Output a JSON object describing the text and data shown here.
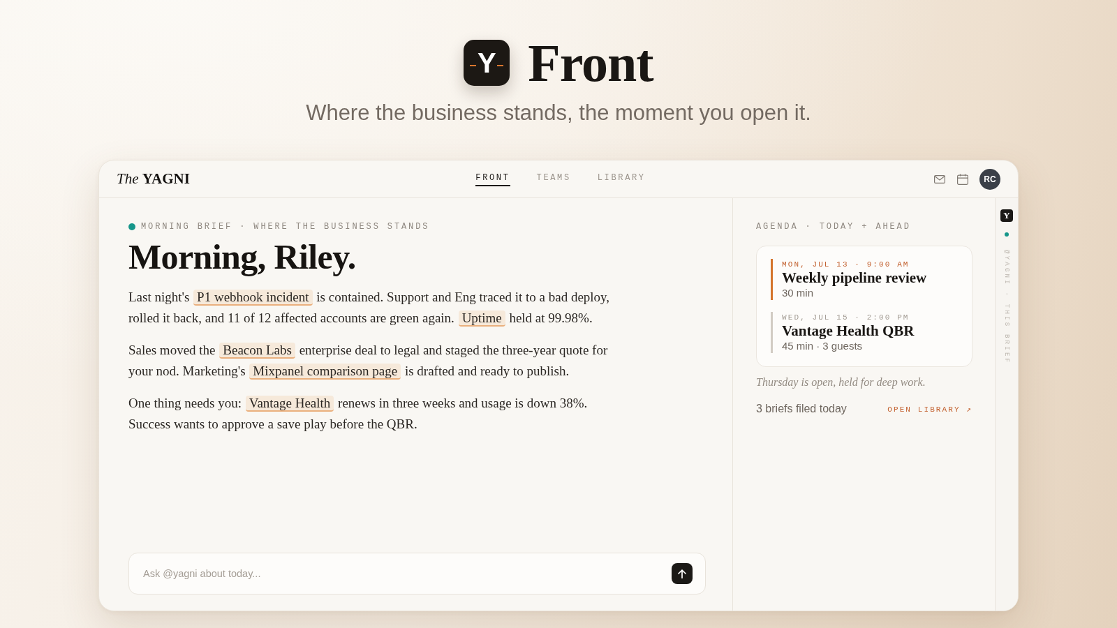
{
  "hero": {
    "logo_letter": "Y",
    "title": "Front",
    "subtitle": "Where the business stands, the moment you open it."
  },
  "app": {
    "header": {
      "wordmark": "*The* **YAGNI**",
      "tabs": [
        {
          "label": "FRONT",
          "selected": true
        },
        {
          "label": "TEAMS",
          "selected": false
        },
        {
          "label": "LIBRARY",
          "selected": false
        }
      ],
      "avatar": "RC"
    },
    "brief": {
      "eyebrow": "MORNING BRIEF · WHERE THE BUSINESS STANDS",
      "heading": "Morning, Riley.",
      "paragraphs": [
        [
          {
            "kind": "text",
            "text": "Last night's "
          },
          {
            "kind": "mention",
            "text": "P1 webhook incident"
          },
          {
            "kind": "text",
            "text": " is contained. Support and Eng traced it to a bad deploy, rolled it back, and 11 of 12 affected accounts are green again. "
          },
          {
            "kind": "mention",
            "text": "Uptime"
          },
          {
            "kind": "text",
            "text": " held at 99.98%."
          }
        ],
        [
          {
            "kind": "text",
            "text": "Sales moved the "
          },
          {
            "kind": "mention",
            "text": "Beacon Labs"
          },
          {
            "kind": "text",
            "text": " enterprise deal to legal and staged the three-year quote for your nod. Marketing's "
          },
          {
            "kind": "mention",
            "text": "Mixpanel comparison page"
          },
          {
            "kind": "text",
            "text": " is drafted and ready to publish."
          }
        ],
        [
          {
            "kind": "text",
            "text": "One thing needs you: "
          },
          {
            "kind": "mention",
            "text": "Vantage Health"
          },
          {
            "kind": "text",
            "text": " renews in three weeks and usage is down 38%. Success wants to approve a save play before the QBR."
          }
        ]
      ]
    },
    "composer": {
      "placeholder": "Ask @yagni about today..."
    },
    "agenda": {
      "eyebrow": "AGENDA · TODAY + AHEAD",
      "events": [
        {
          "when": "MON, JUL 13 · 9:00 AM",
          "title": "Weekly pipeline review",
          "meta": "30 min",
          "current": true
        },
        {
          "when": "WED, JUL 15 · 2:00 PM",
          "title": "Vantage Health QBR",
          "meta": "45 min · 3 guests",
          "current": false
        }
      ],
      "note": "Thursday is open, held for deep work.",
      "count": "3 briefs filed today",
      "link": "OPEN LIBRARY ↗"
    },
    "rail": {
      "logo_letter": "Y",
      "label": "@YAGNI · THIS BRIEF"
    }
  }
}
